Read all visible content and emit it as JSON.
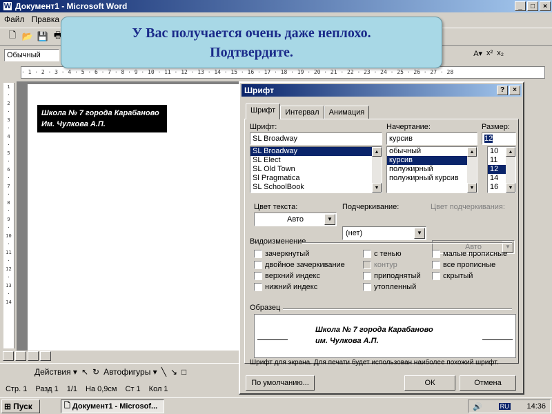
{
  "window": {
    "title": "Документ1 - Microsoft Word",
    "controls": [
      "_",
      "□",
      "×"
    ]
  },
  "menubar": {
    "items": [
      "Файл",
      "Правка"
    ]
  },
  "format_bar": {
    "style_value": "Обычный"
  },
  "banner": {
    "line1": "У Вас получается очень даже неплохо.",
    "line2": "Подтвердите."
  },
  "document": {
    "line1": "Школа № 7 города Карабаново",
    "line2": "Им. Чулкова А.П."
  },
  "drawing_toolbar": {
    "actions_label": "Действия",
    "autoshapes_label": "Автофигуры"
  },
  "statusbar": {
    "page": "Стр. 1",
    "section": "Разд 1",
    "pages": "1/1",
    "at": "На 0,9см",
    "line": "Ст 1",
    "col": "Кол 1"
  },
  "taskbar": {
    "start_label": "Пуск",
    "task_label": "Документ1 - Microsof...",
    "lang": "RU",
    "time": "14:36"
  },
  "dialog": {
    "title": "Шрифт",
    "help": "?",
    "close": "×",
    "tabs": [
      "Шрифт",
      "Интервал",
      "Анимация"
    ],
    "font_label": "Шрифт:",
    "font_value": "SL Broadway",
    "font_list": [
      "SL Broadway",
      "SL Elect",
      "SL Old Town",
      "Sl Pragmatica",
      "SL SchoolBook"
    ],
    "style_label": "Начертание:",
    "style_value": "курсив",
    "style_list": [
      "обычный",
      "курсив",
      "полужирный",
      "полужирный курсив"
    ],
    "size_label": "Размер:",
    "size_value": "12",
    "size_list": [
      "10",
      "11",
      "12",
      "14",
      "16"
    ],
    "color_label": "Цвет текста:",
    "color_value": "Авто",
    "underline_label": "Подчеркивание:",
    "underline_value": "(нет)",
    "underline_color_label": "Цвет подчеркивания:",
    "underline_color_value": "Авто",
    "effects_label": "Видоизменение",
    "effects_col1": [
      "зачеркнутый",
      "двойное зачеркивание",
      "верхний индекс",
      "нижний индекс"
    ],
    "effects_col2": [
      "с тенью",
      "контур",
      "приподнятый",
      "утопленный"
    ],
    "effects_col3": [
      "малые прописные",
      "все прописные",
      "скрытый"
    ],
    "sample_label": "Образец",
    "sample_line1": "Школа № 7 города Карабаново",
    "sample_line2": "им. Чулкова А.П.",
    "hint": "Шрифт для экрана. Для печати будет использован наиболее похожий шрифт.",
    "default_button": "По умолчанию...",
    "ok_button": "ОК",
    "cancel_button": "Отмена"
  }
}
